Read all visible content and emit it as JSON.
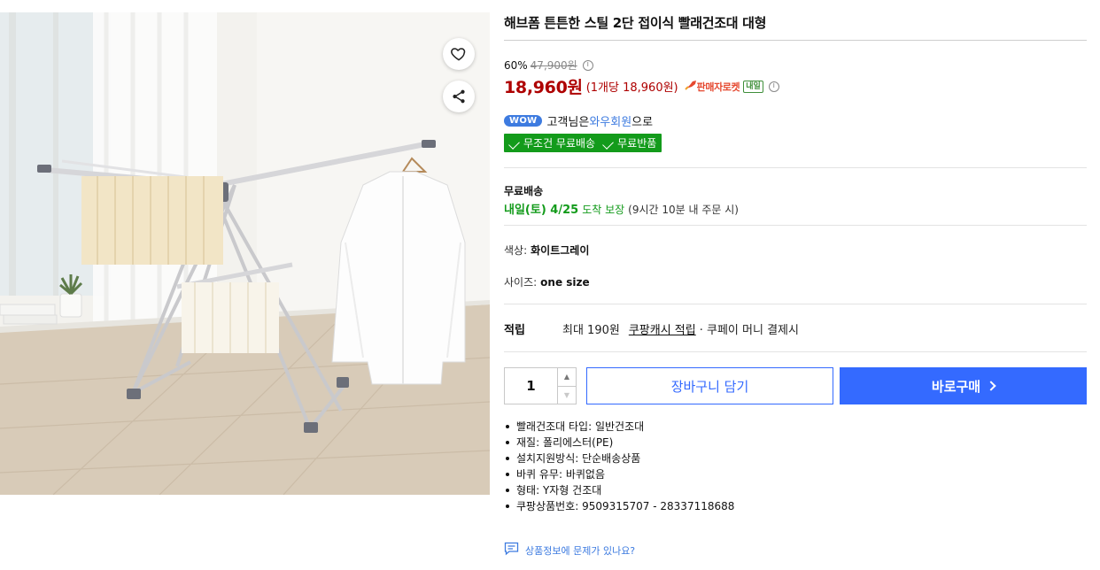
{
  "product": {
    "title": "해브폼 튼튼한 스틸 2단 접이식 빨래건조대 대형",
    "discount_rate": "60%",
    "original_price": "47,900원",
    "sale_price": "18,960원",
    "unit_price": "(1개당 18,960원)",
    "rocket_label": "판매자로켓",
    "rocket_badge": "내일"
  },
  "wow": {
    "badge": "WOW",
    "prefix": "고객님은",
    "member": "와우회원",
    "suffix": "으로",
    "benefit_1": "무조건 무료배송",
    "benefit_2": "무료반품"
  },
  "shipping": {
    "label": "무료배송",
    "date": "내일(토) 4/25",
    "guarantee": "도착 보장",
    "cutoff": "(9시간 10분 내 주문 시)"
  },
  "options": {
    "color_label": "색상:",
    "color_value": "화이트그레이",
    "size_label": "사이즈:",
    "size_value": "one size"
  },
  "points": {
    "label": "적립",
    "text_before": "최대 190원",
    "link": "쿠팡캐시 적립",
    "text_after": "· 쿠페이 머니 결제시"
  },
  "purchase": {
    "quantity": "1",
    "cart_label": "장바구니 담기",
    "buy_label": "바로구매"
  },
  "specs": [
    "빨래건조대 타입: 일반건조대",
    "재질: 폴리에스터(PE)",
    "설치지원방식: 단순배송상품",
    "바퀴 유무: 바퀴없음",
    "형태: Y자형 건조대",
    "쿠팡상품번호: 9509315707 - 28337118688"
  ],
  "report_link": "상품정보에 문제가 있나요?",
  "colors": {
    "price_red": "#ae0000",
    "coupang_blue": "#346aff",
    "wow_blue": "#3d7be0",
    "rocket_green": "#139b1b"
  }
}
